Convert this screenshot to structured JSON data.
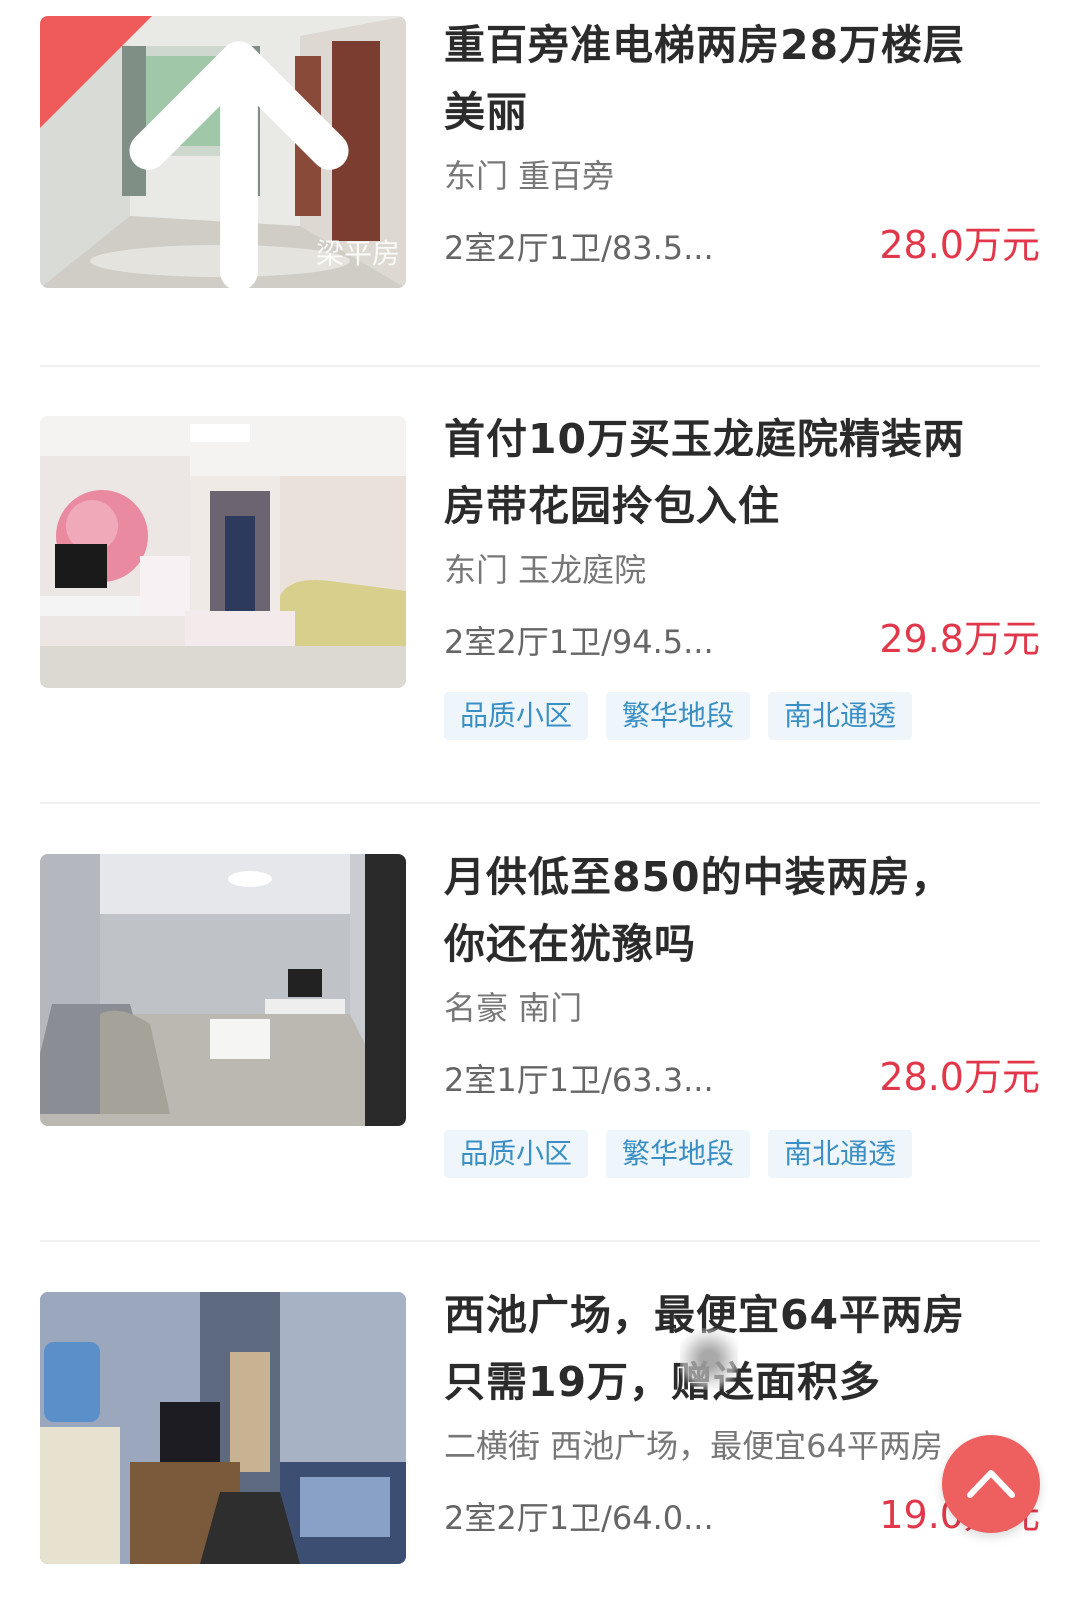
{
  "listings": [
    {
      "title_line1": "重百旁准电梯两房28万楼层",
      "title_line2": "美丽",
      "location": "东门 重百旁",
      "specs": "2室2厅1卫/83.5...",
      "price": "28.0万元",
      "watermark": "梁平房",
      "tags": []
    },
    {
      "title_line1": "首付10万买玉龙庭院精装两",
      "title_line2": "房带花园拎包入住",
      "location": "东门 玉龙庭院",
      "specs": "2室2厅1卫/94.5...",
      "price": "29.8万元",
      "tags": [
        "品质小区",
        "繁华地段",
        "南北通透"
      ]
    },
    {
      "title_line1": "月供低至850的中装两房，",
      "title_line2": "你还在犹豫吗",
      "location": "名豪 南门",
      "specs": "2室1厅1卫/63.3...",
      "price": "28.0万元",
      "tags": [
        "品质小区",
        "繁华地段",
        "南北通透"
      ]
    },
    {
      "title_line1": "西池广场，最便宜64平两房",
      "title_line2": "只需19万，赠送面积多",
      "location": "二横街 西池广场，最便宜64平两房",
      "specs": "2室2厅1卫/64.0...",
      "price": "19.0万元",
      "tags": []
    }
  ],
  "colors": {
    "price": "#e0384a",
    "tag_text": "#3a8fc4",
    "tag_bg": "#eef6fb",
    "badge": "#ef5a5a"
  },
  "icons": {
    "top_badge": "arrow-up-icon",
    "scroll_top": "chevron-up-icon"
  }
}
